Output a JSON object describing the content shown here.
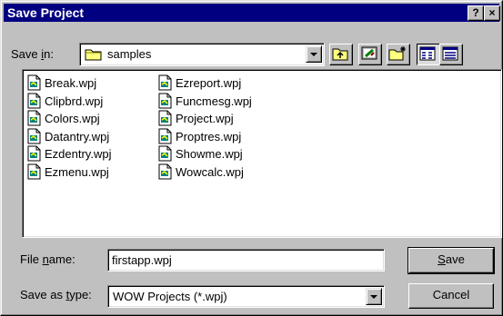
{
  "window": {
    "title": "Save Project",
    "help_label": "?",
    "close_label": "×"
  },
  "save_in": {
    "label_pre": "Save ",
    "label_key": "i",
    "label_post": "n:",
    "value": "samples",
    "icon": "folder-icon"
  },
  "toolbar": [
    {
      "name": "up-one-level",
      "icon": "folder-up-icon"
    },
    {
      "name": "desktop",
      "icon": "desktop-icon"
    },
    {
      "name": "new-folder",
      "icon": "new-folder-icon"
    },
    {
      "name": "list-view",
      "icon": "list-view-icon",
      "pressed": true
    },
    {
      "name": "details-view",
      "icon": "details-view-icon"
    }
  ],
  "files": {
    "column1": [
      "Break.wpj",
      "Clipbrd.wpj",
      "Colors.wpj",
      "Datantry.wpj",
      "Ezdentry.wpj",
      "Ezmenu.wpj"
    ],
    "column2": [
      "Ezreport.wpj",
      "Funcmesg.wpj",
      "Project.wpj",
      "Proptres.wpj",
      "Showme.wpj",
      "Wowcalc.wpj"
    ],
    "icon": "project-file-icon"
  },
  "file_name": {
    "label_pre": "File ",
    "label_key": "n",
    "label_post": "ame:",
    "value": "firstapp.wpj"
  },
  "save_as_type": {
    "label_pre": "Save as ",
    "label_key": "t",
    "label_post": "ype:",
    "value": "WOW Projects (*.wpj)"
  },
  "buttons": {
    "save_key": "S",
    "save_rest": "ave",
    "cancel": "Cancel"
  }
}
